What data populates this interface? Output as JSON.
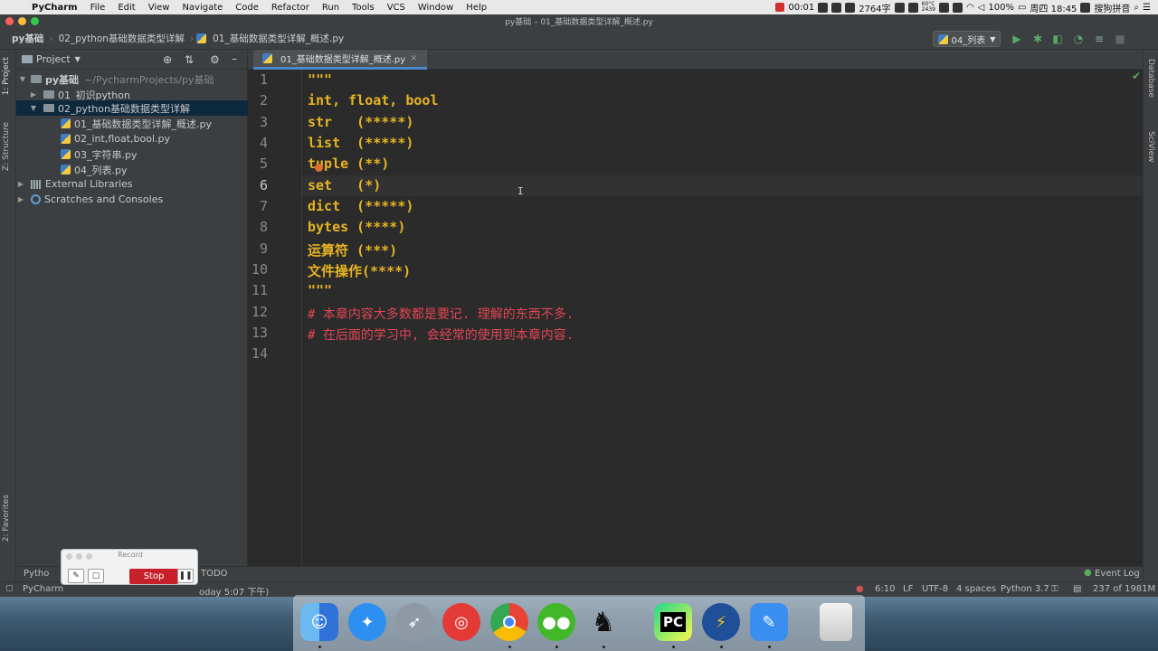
{
  "menubar": {
    "app": "PyCharm",
    "items": [
      "File",
      "Edit",
      "View",
      "Navigate",
      "Code",
      "Refactor",
      "Run",
      "Tools",
      "VCS",
      "Window",
      "Help"
    ],
    "rec_time": "00:01",
    "word_count": "2764字",
    "temp_top": "60°C",
    "temp_bottom": "2439",
    "battery": "100%",
    "clock": "周四 18:45",
    "input_method": "搜狗拼音"
  },
  "window": {
    "title": "py基础 – 01_基础数据类型详解_概述.py"
  },
  "navbar": {
    "crumbs": [
      "py基础",
      "02_python基础数据类型详解",
      "01_基础数据类型详解_概述.py"
    ],
    "run_config": "04_列表"
  },
  "left_strip": {
    "project_tab": "1: Project",
    "structure_tab": "Z: Structure",
    "favorites_tab": "2: Favorites"
  },
  "project": {
    "header": "Project",
    "root": {
      "name": "py基础",
      "path": "~/PycharmProjects/py基础"
    },
    "folders": [
      "01_初识python",
      "02_python基础数据类型详解"
    ],
    "files": [
      "01_基础数据类型详解_概述.py",
      "02_int,float,bool.py",
      "03_字符串.py",
      "04_列表.py"
    ],
    "external": "External Libraries",
    "scratches": "Scratches and Consoles"
  },
  "editor": {
    "tab": "01_基础数据类型详解_概述.py",
    "lines": [
      "\"\"\"",
      "int, float, bool",
      "str   (*****)",
      "list  (*****)",
      "tuple (**)",
      "set   (*)",
      "dict  (*****)",
      "bytes (****)",
      "运算符 (***)",
      "文件操作(****)",
      "\"\"\"",
      "# 本章内容大多数都是要记. 理解的东西不多.",
      "# 在后面的学习中, 会经常的使用到本章内容.",
      ""
    ],
    "line_numbers": [
      "1",
      "2",
      "3",
      "4",
      "5",
      "6",
      "7",
      "8",
      "9",
      "10",
      "11",
      "12",
      "13",
      "14"
    ]
  },
  "right_strip": {
    "database": "Database",
    "sciview": "SciView"
  },
  "bottom_tools": {
    "python_console": "Pytho",
    "todo": "TODO",
    "event_log": "Event Log"
  },
  "status": {
    "message": "PyCharm",
    "message_tail": "oday 5:07 下午)",
    "position": "6:10",
    "line_sep": "LF",
    "encoding": "UTF-8",
    "indent": "4 spaces",
    "interpreter": "Python 3.7",
    "memory": "237 of 1981M"
  },
  "record_widget": {
    "title": "Record",
    "stop": "Stop"
  },
  "colors": {
    "docstring": "#e6b422",
    "comment": "#e04553",
    "selection": "#0d293e"
  }
}
